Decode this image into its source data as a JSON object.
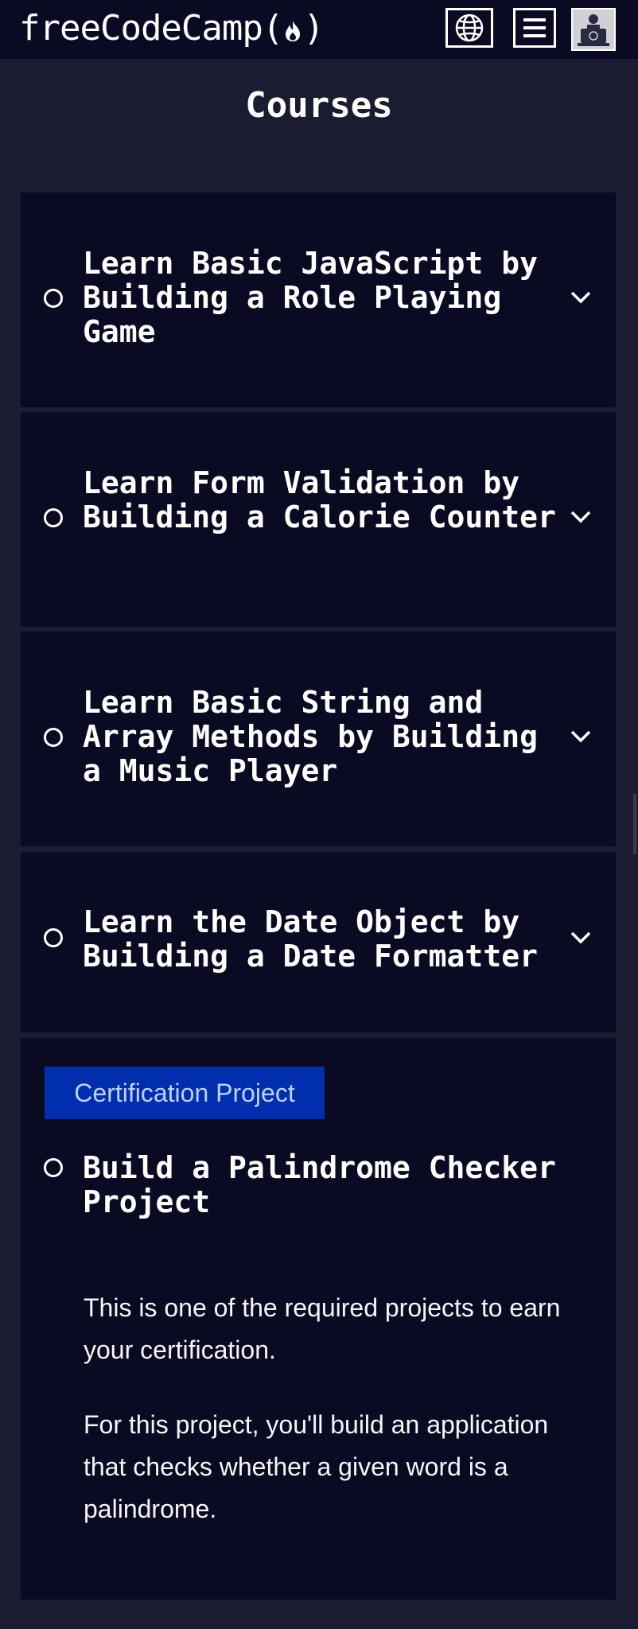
{
  "navbar": {
    "logo_text": "freeCodeCamp",
    "logo_paren_open": "(",
    "logo_paren_close": ")",
    "logo_icon": "flame-icon",
    "language_button_icon": "globe-icon",
    "menu_button_icon": "hamburger-menu-icon",
    "avatar_icon": "user-avatar-icon"
  },
  "page": {
    "title": "Courses"
  },
  "blocks": [
    {
      "title": "Learn Basic JavaScript by Building a Role Playing Game",
      "status_icon": "incomplete-circle-icon",
      "expand_icon": "chevron-down-icon"
    },
    {
      "title": "Learn Form Validation by Building a Calorie Counter",
      "status_icon": "incomplete-circle-icon",
      "expand_icon": "chevron-down-icon"
    },
    {
      "title": "Learn Basic String and Array Methods by Building a Music Player",
      "status_icon": "incomplete-circle-icon",
      "expand_icon": "chevron-down-icon"
    },
    {
      "title": "Learn the Date Object by Building a Date Formatter",
      "status_icon": "incomplete-circle-icon",
      "expand_icon": "chevron-down-icon"
    }
  ],
  "cert_project": {
    "badge": "Certification Project",
    "title": "Build a Palindrome Checker Project",
    "status_icon": "incomplete-circle-icon",
    "paragraph_1": "This is one of the required projects to earn your certification.",
    "paragraph_2": "For this project, you'll build an application that checks whether a given word is a palindrome."
  },
  "colors": {
    "background": "#1b1b32",
    "navbar": "#0a0a23",
    "block_background": "#0a0a23",
    "badge_background": "#002ead",
    "badge_text": "#bdd0ff",
    "text": "#ffffff"
  }
}
